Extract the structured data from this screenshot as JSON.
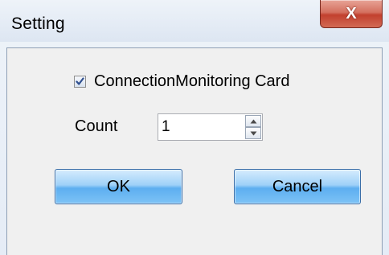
{
  "window": {
    "title": "Setting",
    "close_symbol": "X",
    "close_icon": "close-icon"
  },
  "form": {
    "checkbox_label": "ConnectionMonitoring Card",
    "checkbox_checked": true,
    "count_label": "Count",
    "count_value": "1"
  },
  "buttons": {
    "ok_label": "OK",
    "cancel_label": "Cancel"
  },
  "colors": {
    "button_accent": "#5daef0",
    "close_accent": "#c2402e",
    "check_mark": "#2f4f8f"
  }
}
